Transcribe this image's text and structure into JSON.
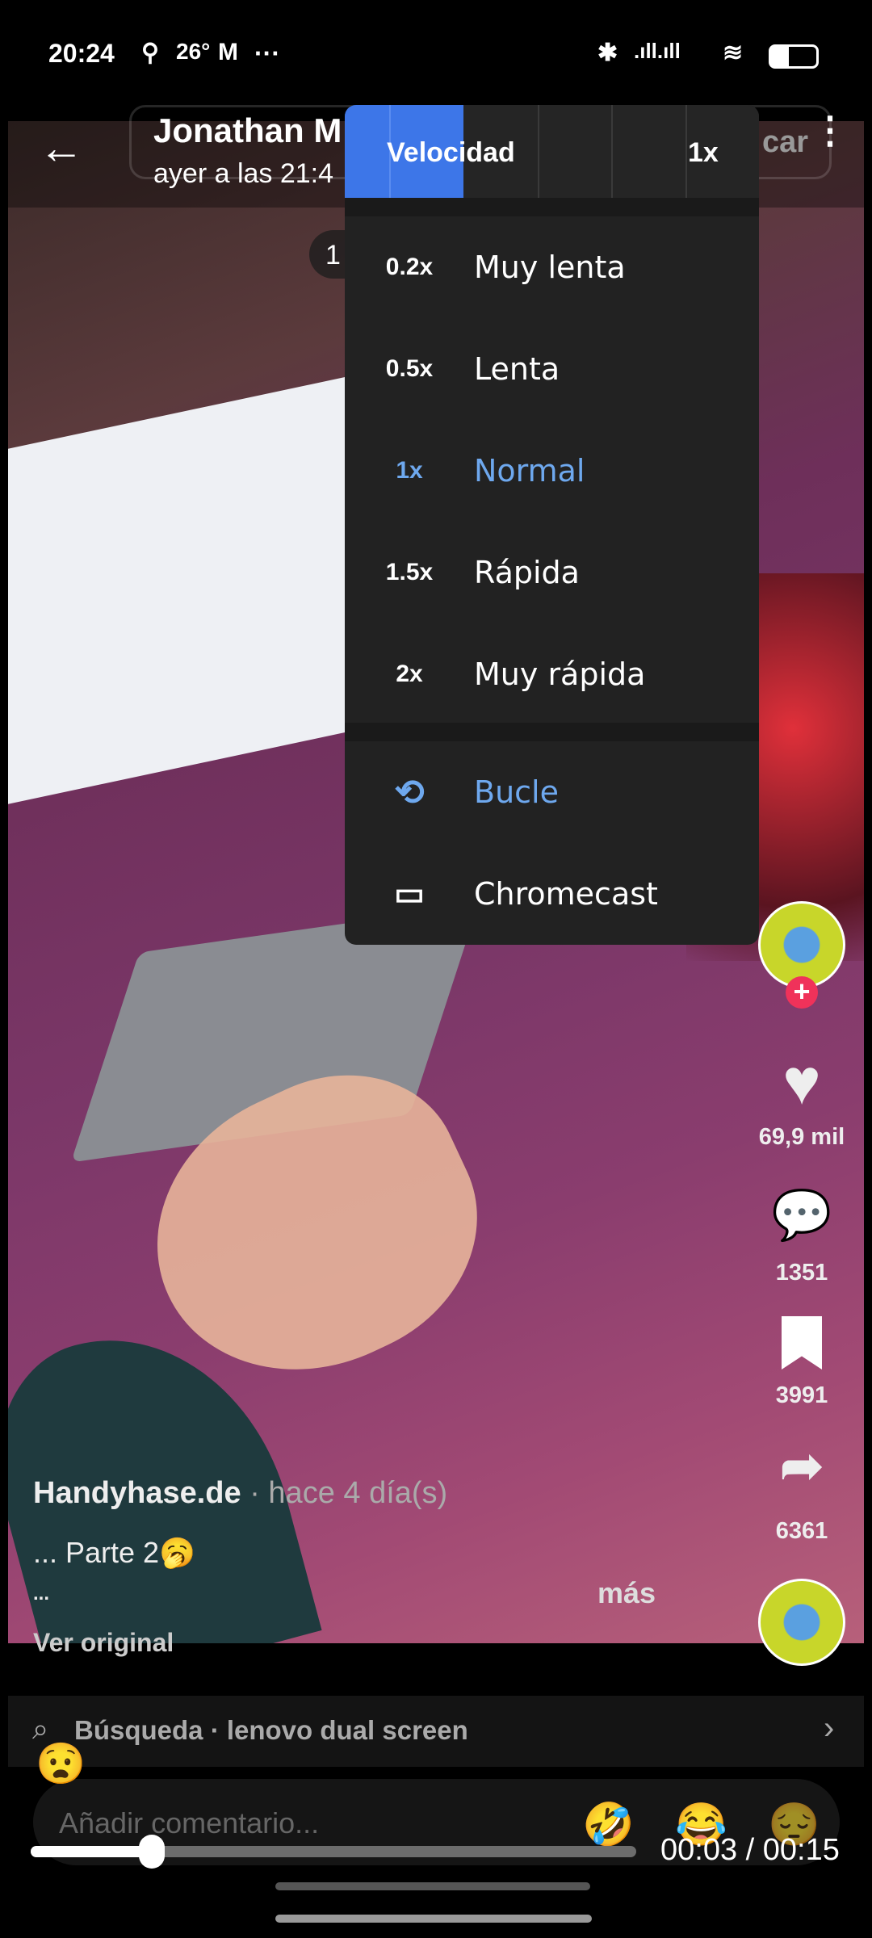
{
  "status": {
    "time": "20:24",
    "temp": "26°",
    "dots": "···"
  },
  "header": {
    "name": "Jonathan M",
    "subtitle": "ayer a las 21:4",
    "search_partial": "car"
  },
  "counter": {
    "text": "1"
  },
  "menu": {
    "title": "Velocidad",
    "current": "1x",
    "speeds": [
      {
        "value": "0.2x",
        "label": "Muy lenta",
        "selected": false
      },
      {
        "value": "0.5x",
        "label": "Lenta",
        "selected": false
      },
      {
        "value": "1x",
        "label": "Normal",
        "selected": true
      },
      {
        "value": "1.5x",
        "label": "Rápida",
        "selected": false
      },
      {
        "value": "2x",
        "label": "Muy rápida",
        "selected": false
      }
    ],
    "loop": "Bucle",
    "cast": "Chromecast",
    "accent": "#3d76e8",
    "selected_color": "#6ea8ee"
  },
  "actions": {
    "likes": "69,9 mil",
    "comments": "1351",
    "saves": "3991",
    "shares": "6361"
  },
  "post": {
    "author": "Handyhase.de",
    "time": " · hace 4 día(s)",
    "caption": "... Parte 2",
    "caption_emoji": "🥱",
    "ellipsis": "...",
    "more": "más",
    "translate": "Ver original"
  },
  "search": {
    "text": "Búsqueda · lenovo dual screen"
  },
  "comment": {
    "placeholder": "Añadir comentario...",
    "float_emoji": "😧",
    "emojis": [
      "🤣",
      "😂",
      "😔"
    ]
  },
  "player": {
    "time": "00:03 / 00:15",
    "progress": 0.2
  }
}
